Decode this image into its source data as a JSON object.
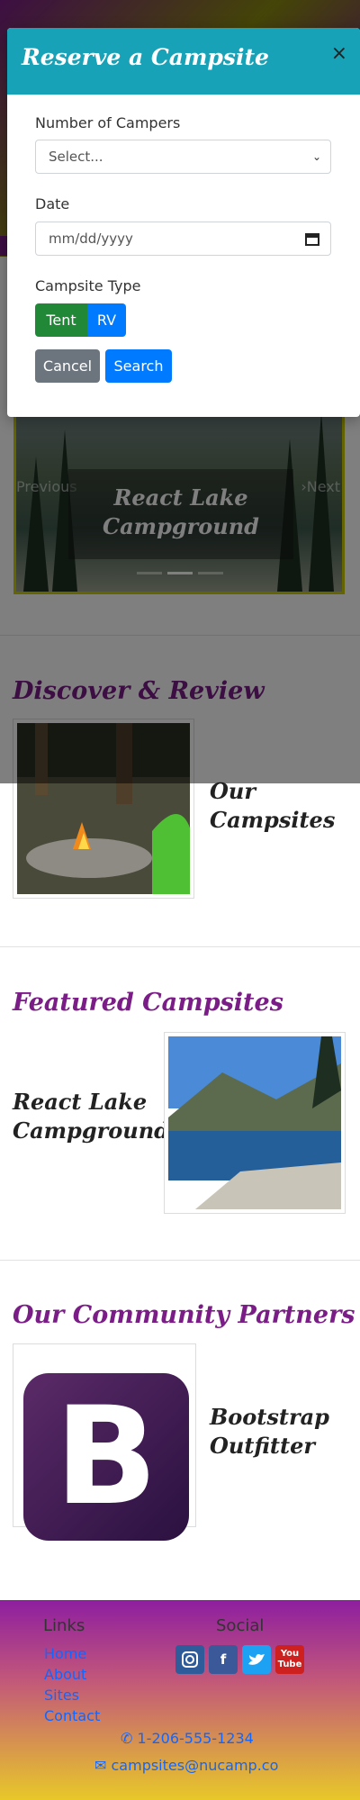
{
  "carousel": {
    "caption_line1": "React Lake",
    "caption_line2": "Campground",
    "prev_label": "Previous",
    "next_label": "Next"
  },
  "discover": {
    "title": "Discover & Review",
    "card_title_line1": "Our",
    "card_title_line2": "Campsites"
  },
  "featured": {
    "title": "Featured Campsites",
    "card_title_line1": "React Lake",
    "card_title_line2": "Campground"
  },
  "partners": {
    "title": "Our Community Partners",
    "logo_letter": "B",
    "card_title_line1": "Bootstrap",
    "card_title_line2": "Outfitter"
  },
  "footer": {
    "links_heading": "Links",
    "links": [
      "Home",
      "About",
      "Sites",
      "Contact"
    ],
    "social_heading": "Social",
    "social_icons": [
      "instagram-icon",
      "facebook-icon",
      "twitter-icon",
      "youtube-icon"
    ],
    "youtube_label_line1": "You",
    "youtube_label_line2": "Tube",
    "phone": "1-206-555-1234",
    "email": "campsites@nucamp.co"
  },
  "modal": {
    "title": "Reserve a Campsite",
    "close_glyph": "×",
    "campers_label": "Number of Campers",
    "campers_selected": "Select...",
    "date_label": "Date",
    "date_placeholder": "mm/dd/yyyy",
    "type_label": "Campsite Type",
    "type_options": [
      "Tent",
      "RV"
    ],
    "selected_type": "Tent",
    "cancel_label": "Cancel",
    "search_label": "Search"
  },
  "colors": {
    "brand_purple": "#7a1d86",
    "modal_header": "#17a2b8",
    "primary": "#007bff",
    "success": "#218838",
    "secondary": "#6c757d"
  }
}
